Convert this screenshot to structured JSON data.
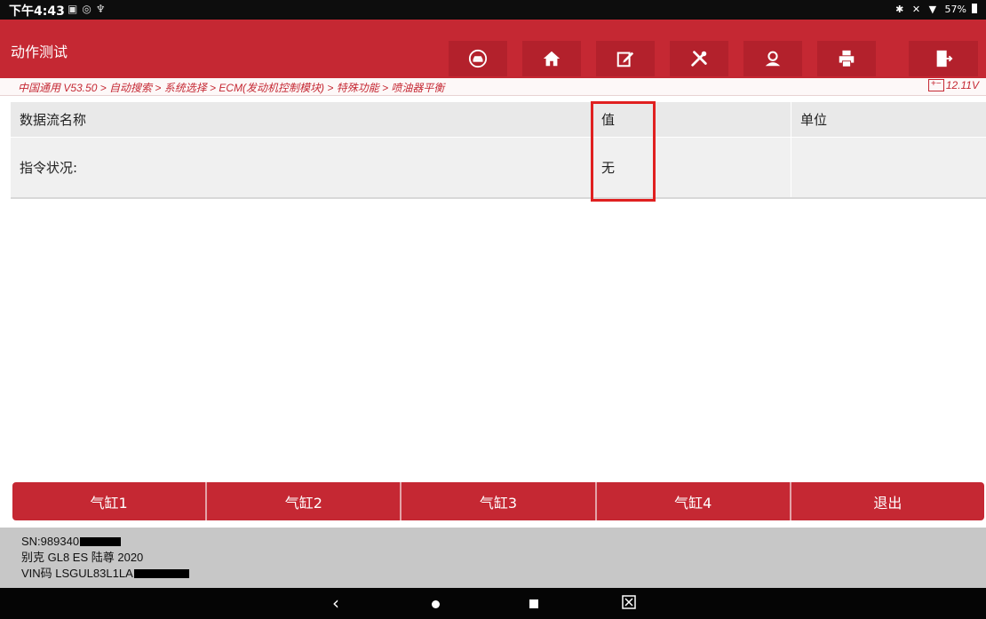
{
  "status": {
    "time": "下午4:43",
    "icons": [
      "message-icon",
      "camera-icon",
      "usb-debug-icon"
    ],
    "right_icons": [
      "bluetooth-icon",
      "mute-icon",
      "wifi-icon"
    ],
    "battery": "57%"
  },
  "header": {
    "title": "动作测试",
    "toolbar": [
      {
        "name": "vehicle-icon"
      },
      {
        "name": "home-icon"
      },
      {
        "name": "report-edit-icon"
      },
      {
        "name": "tools-icon"
      },
      {
        "name": "user-icon"
      },
      {
        "name": "print-icon"
      },
      {
        "name": "exit-icon"
      }
    ]
  },
  "breadcrumb": {
    "path": "中国通用 V53.50 > 自动搜索 > 系统选择 > ECM(发动机控制模块) > 特殊功能 > 喷油器平衡",
    "voltage": "12.11V"
  },
  "table": {
    "headers": {
      "name": "数据流名称",
      "value": "值",
      "unit": "单位"
    },
    "rows": [
      {
        "name": "指令状况:",
        "value": "无",
        "unit": ""
      }
    ]
  },
  "actions": {
    "cyl1": "气缸1",
    "cyl2": "气缸2",
    "cyl3": "气缸3",
    "cyl4": "气缸4",
    "exit": "退出"
  },
  "vehicle": {
    "sn": "SN:989340",
    "model": "别克 GL8 ES 陆尊 2020",
    "vin": "VIN码 LSGUL83L1LA"
  },
  "colors": {
    "brand_red": "#c52833",
    "highlight_red": "#e02020"
  }
}
